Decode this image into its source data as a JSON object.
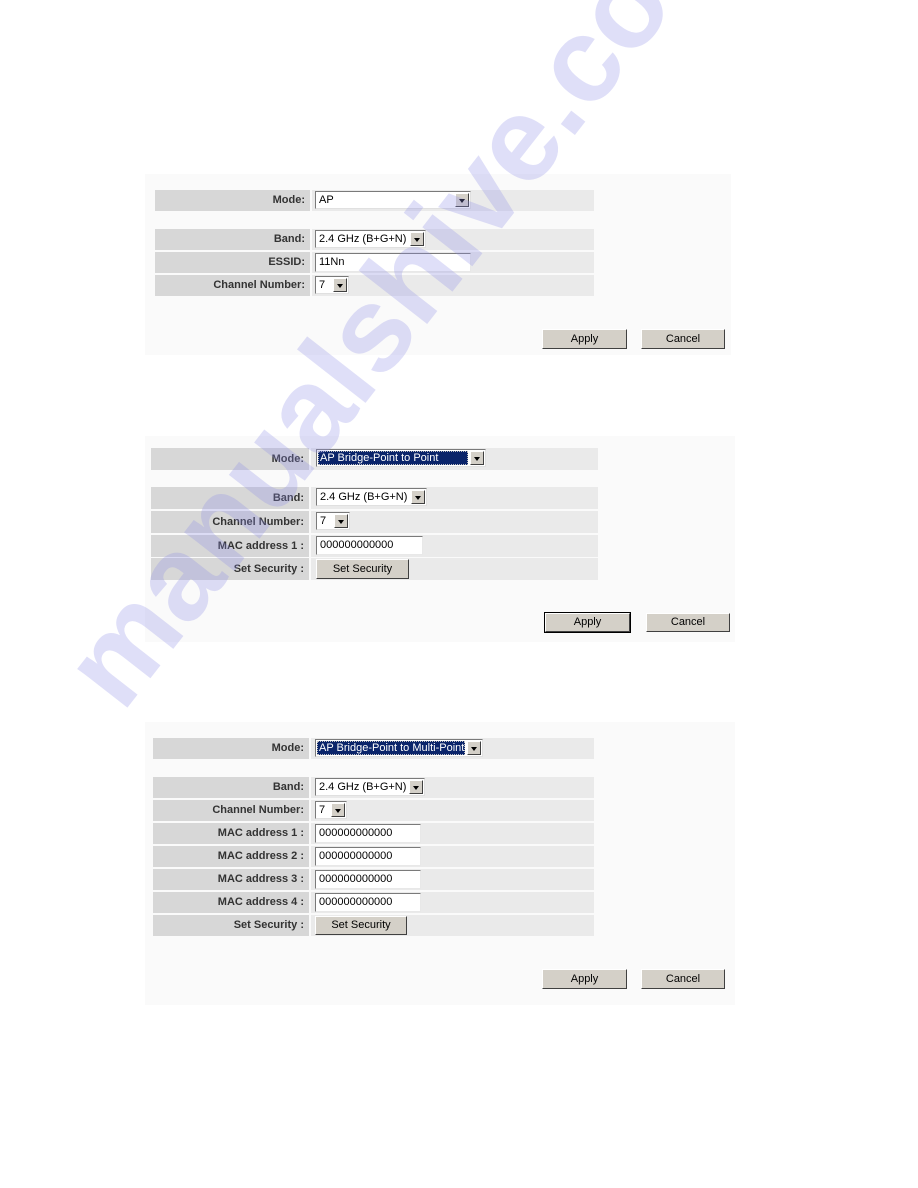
{
  "panels": [
    {
      "mode_label": "Mode:",
      "mode_value": "AP",
      "rows": {
        "band_label": "Band:",
        "band_value": "2.4 GHz (B+G+N)",
        "essid_label": "ESSID:",
        "essid_value": "11Nn",
        "channel_label": "Channel Number:",
        "channel_value": "7"
      },
      "apply_label": "Apply",
      "cancel_label": "Cancel"
    },
    {
      "mode_label": "Mode:",
      "mode_value": "AP Bridge-Point to Point",
      "rows": {
        "band_label": "Band:",
        "band_value": "2.4 GHz (B+G+N)",
        "channel_label": "Channel Number:",
        "channel_value": "7",
        "mac1_label": "MAC address 1 :",
        "mac1_value": "000000000000",
        "security_label": "Set Security :",
        "security_button": "Set Security"
      },
      "apply_label": "Apply",
      "cancel_label": "Cancel"
    },
    {
      "mode_label": "Mode:",
      "mode_value": "AP Bridge-Point to Multi-Point",
      "rows": {
        "band_label": "Band:",
        "band_value": "2.4 GHz (B+G+N)",
        "channel_label": "Channel Number:",
        "channel_value": "7",
        "mac1_label": "MAC address 1 :",
        "mac1_value": "000000000000",
        "mac2_label": "MAC address 2 :",
        "mac2_value": "000000000000",
        "mac3_label": "MAC address 3 :",
        "mac3_value": "000000000000",
        "mac4_label": "MAC address 4 :",
        "mac4_value": "000000000000",
        "security_label": "Set Security :",
        "security_button": "Set Security"
      },
      "apply_label": "Apply",
      "cancel_label": "Cancel"
    }
  ],
  "watermark": "manualshive.com",
  "colors": {
    "label_cell": "#d7d7d7",
    "value_cell": "#eaeaea",
    "selection": "#0a246a",
    "button_face": "#d4d0c8"
  }
}
